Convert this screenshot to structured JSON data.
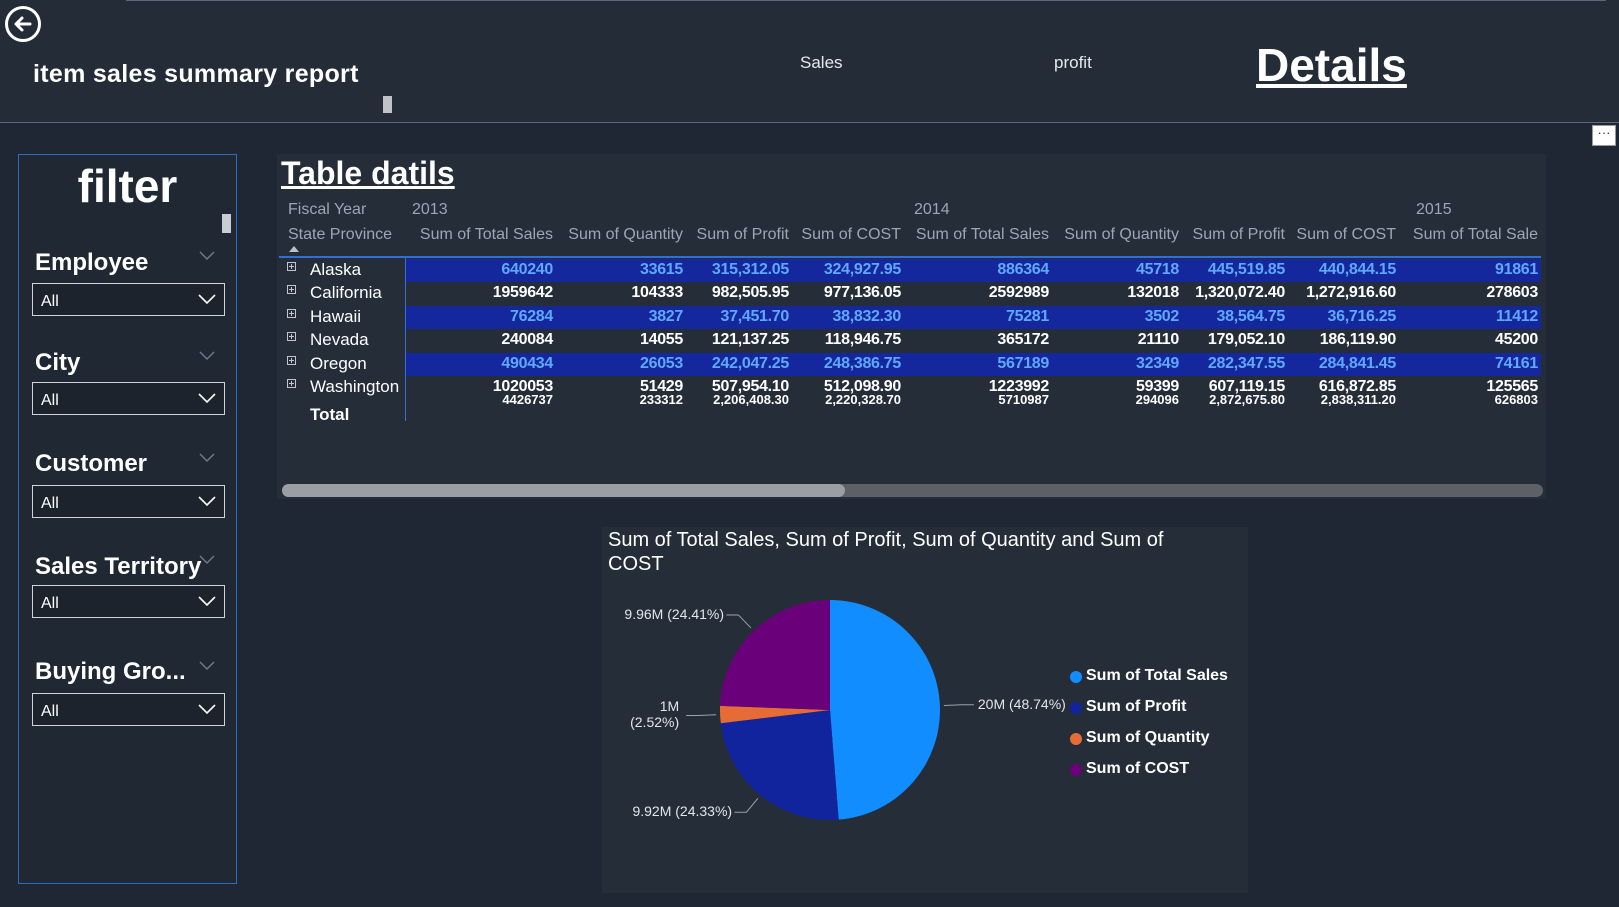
{
  "header": {
    "title": "item sales summary report",
    "back_icon": "back-arrow-icon",
    "nav": {
      "sales": "Sales",
      "profit": "profit",
      "details": "Details"
    },
    "more_label": "···"
  },
  "filter": {
    "title": "filter",
    "slicers": [
      {
        "label": "Employee",
        "value": "All"
      },
      {
        "label": "City",
        "value": "All"
      },
      {
        "label": "Customer",
        "value": "All"
      },
      {
        "label": "Sales Territory",
        "value": "All"
      },
      {
        "label": "Buying Gro...",
        "value": "All"
      }
    ]
  },
  "table": {
    "title": "Table datils",
    "fiscal_year_label": "Fiscal Year",
    "row_header": "State Province",
    "years": [
      "2013",
      "2014",
      "2015"
    ],
    "columns": [
      "Sum of Total Sales",
      "Sum of Quantity",
      "Sum of Profit",
      "Sum of COST",
      "Sum of Total Sales",
      "Sum of Quantity",
      "Sum of Profit",
      "Sum of COST",
      "Sum of Total Sale"
    ],
    "rows": [
      {
        "state": "Alaska",
        "highlight": true,
        "values": [
          "640240",
          "33615",
          "315,312.05",
          "324,927.95",
          "886364",
          "45718",
          "445,519.85",
          "440,844.15",
          "91861"
        ]
      },
      {
        "state": "California",
        "highlight": false,
        "values": [
          "1959642",
          "104333",
          "982,505.95",
          "977,136.05",
          "2592989",
          "132018",
          "1,320,072.40",
          "1,272,916.60",
          "278603"
        ]
      },
      {
        "state": "Hawaii",
        "highlight": true,
        "values": [
          "76284",
          "3827",
          "37,451.70",
          "38,832.30",
          "75281",
          "3502",
          "38,564.75",
          "36,716.25",
          "11412"
        ]
      },
      {
        "state": "Nevada",
        "highlight": false,
        "values": [
          "240084",
          "14055",
          "121,137.25",
          "118,946.75",
          "365172",
          "21110",
          "179,052.10",
          "186,119.90",
          "45200"
        ]
      },
      {
        "state": "Oregon",
        "highlight": true,
        "values": [
          "490434",
          "26053",
          "242,047.25",
          "248,386.75",
          "567189",
          "32349",
          "282,347.55",
          "284,841.45",
          "74161"
        ]
      },
      {
        "state": "Washington",
        "highlight": false,
        "values": [
          "1020053",
          "51429",
          "507,954.10",
          "512,098.90",
          "1223992",
          "59399",
          "607,119.15",
          "616,872.85",
          "125565"
        ]
      }
    ],
    "total": {
      "label": "Total",
      "values": [
        "4426737",
        "233312",
        "2,206,408.30",
        "2,220,328.70",
        "5710987",
        "294096",
        "2,872,675.80",
        "2,838,311.20",
        "626803"
      ]
    },
    "highlight_color": "#14279c",
    "highlight_text_color": "#5fa8ff"
  },
  "pie": {
    "title": "Sum of Total Sales, Sum of Profit, Sum of Quantity and Sum of COST",
    "chart_data": {
      "type": "pie",
      "categories": [
        "Sum of Total Sales",
        "Sum of Profit",
        "Sum of Quantity",
        "Sum of COST"
      ],
      "values": [
        48.74,
        24.33,
        2.52,
        24.41
      ],
      "labels": [
        {
          "value": "20M",
          "percent": "(48.74%)"
        },
        {
          "value": "9.92M",
          "percent": "(24.33%)"
        },
        {
          "value": "1M",
          "percent": "(2.52%)"
        },
        {
          "value": "9.96M",
          "percent": "(24.41%)"
        }
      ],
      "colors": [
        "#118dff",
        "#12239e",
        "#e66c37",
        "#6b007b"
      ]
    }
  }
}
